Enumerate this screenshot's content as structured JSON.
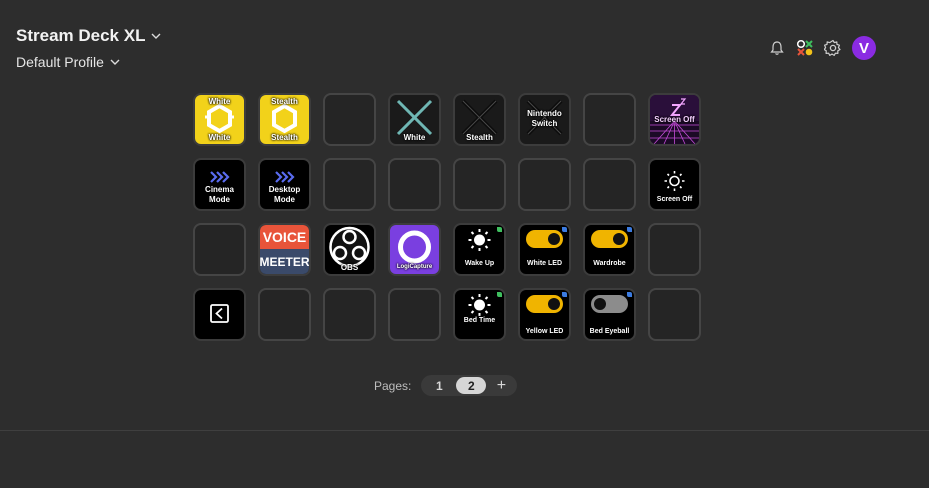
{
  "header": {
    "device_name": "Stream Deck XL",
    "profile_name": "Default Profile"
  },
  "top_icons": [
    "bell-icon",
    "marketplace-icon",
    "gear-icon"
  ],
  "avatar_initial": "V",
  "keys": {
    "r1c1": {
      "top": "White",
      "bottom": "White"
    },
    "r1c2": {
      "top": "Stealth",
      "bottom": "Stealth"
    },
    "r1c4": {
      "bottom": "White"
    },
    "r1c5": {
      "bottom": "Stealth"
    },
    "r1c6": {
      "top": "Nintendo",
      "top2": "Switch"
    },
    "r1c8": {
      "label": "Screen Off"
    },
    "r2c1": {
      "label1": "Cinema",
      "label2": "Mode"
    },
    "r2c2": {
      "label1": "Desktop",
      "label2": "Mode"
    },
    "r2c8": {
      "bottom": "Screen Off"
    },
    "r3c2": {
      "top": "VOICE",
      "bottom": "MEETER"
    },
    "r3c3": {
      "bottom": "OBS"
    },
    "r3c4": {
      "bottom": "LogiCapture"
    },
    "r3c5": {
      "bottom": "Wake Up"
    },
    "r3c6": {
      "bottom": "White LED"
    },
    "r3c7": {
      "bottom": "Wardrobe"
    },
    "r4c5": {
      "bottom": "Bed Time"
    },
    "r4c6": {
      "bottom": "Yellow LED"
    },
    "r4c7": {
      "bottom": "Bed Eyeball"
    }
  },
  "pages": {
    "label": "Pages:",
    "items": [
      "1",
      "2"
    ],
    "active": "2",
    "add": "+"
  },
  "colors": {
    "accent_purple": "#8a2be2",
    "key_yellow": "#f2d21a",
    "toggle_yellow": "#f0b400",
    "status_green": "#3fbf5f",
    "status_blue": "#3b7be0"
  }
}
